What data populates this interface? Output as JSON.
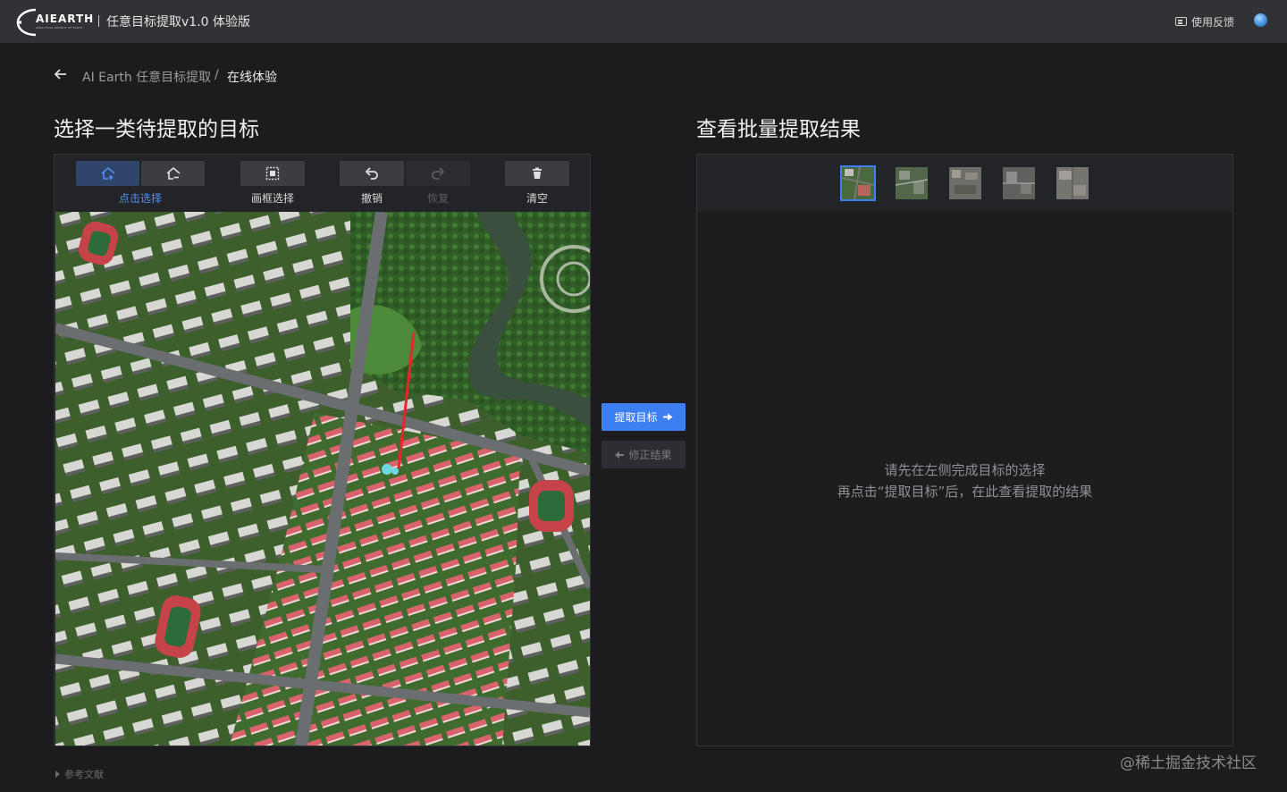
{
  "topbar": {
    "logo_text": "AIEARTH",
    "logo_sub": "ANALYTICAL INSIGHT OF EARTH",
    "app_title": "任意目标提取v1.0 体验版",
    "feedback_label": "使用反馈"
  },
  "breadcrumb": {
    "parent": "AI Earth 任意目标提取",
    "separator": "/",
    "current": "在线体验"
  },
  "left": {
    "heading": "选择一类待提取的目标",
    "tools": [
      {
        "label": "点击选择",
        "icon": "point-select-icon",
        "state": "active"
      },
      {
        "label": "画框选择",
        "icon": "box-select-icon",
        "state": "normal"
      },
      {
        "label": "撤销",
        "icon": "undo-icon",
        "state": "normal"
      },
      {
        "label": "恢复",
        "icon": "redo-icon",
        "state": "disabled"
      },
      {
        "label": "清空",
        "icon": "trash-icon",
        "state": "normal"
      }
    ]
  },
  "actions": {
    "extract_label": "提取目标",
    "fix_label": "修正结果"
  },
  "right": {
    "heading": "查看批量提取结果",
    "thumbnails": [
      "thumb-1",
      "thumb-2",
      "thumb-3",
      "thumb-4",
      "thumb-5"
    ],
    "selected_thumbnail": 1,
    "empty_line1": "请先在左侧完成目标的选择",
    "empty_line2": "再点击“提取目标”后，在此查看提取的结果"
  },
  "footer": {
    "refs_label": "参考文献",
    "watermark": "@稀土掘金技术社区"
  },
  "colors": {
    "accent": "#3d7ef0",
    "topbar": "#303236",
    "background": "#1c1c1f"
  }
}
